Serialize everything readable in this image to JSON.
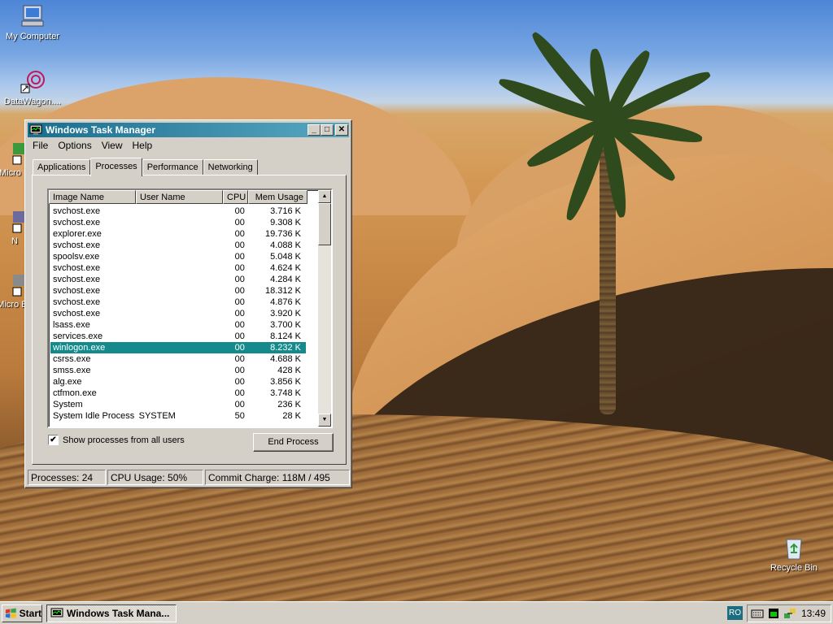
{
  "desktop": {
    "icons": [
      {
        "label": "My Computer"
      },
      {
        "label": "DataWagon...."
      },
      {
        "label": "Micro D"
      },
      {
        "label": "N"
      },
      {
        "label": "Micro Ba"
      },
      {
        "label": "Recycle Bin"
      }
    ]
  },
  "window": {
    "title": "Windows Task Manager",
    "controls": {
      "minimize": "_",
      "maximize": "□",
      "close": "✕"
    },
    "menu": [
      "File",
      "Options",
      "View",
      "Help"
    ],
    "tabs": [
      "Applications",
      "Processes",
      "Performance",
      "Networking"
    ],
    "active_tab": "Processes",
    "columns": [
      "Image Name",
      "User Name",
      "CPU",
      "Mem Usage"
    ],
    "processes": [
      {
        "name": "svchost.exe",
        "user": "",
        "cpu": "00",
        "mem": "3.716 K"
      },
      {
        "name": "svchost.exe",
        "user": "",
        "cpu": "00",
        "mem": "9.308 K"
      },
      {
        "name": "explorer.exe",
        "user": "",
        "cpu": "00",
        "mem": "19.736 K"
      },
      {
        "name": "svchost.exe",
        "user": "",
        "cpu": "00",
        "mem": "4.088 K"
      },
      {
        "name": "spoolsv.exe",
        "user": "",
        "cpu": "00",
        "mem": "5.048 K"
      },
      {
        "name": "svchost.exe",
        "user": "",
        "cpu": "00",
        "mem": "4.624 K"
      },
      {
        "name": "svchost.exe",
        "user": "",
        "cpu": "00",
        "mem": "4.284 K"
      },
      {
        "name": "svchost.exe",
        "user": "",
        "cpu": "00",
        "mem": "18.312 K"
      },
      {
        "name": "svchost.exe",
        "user": "",
        "cpu": "00",
        "mem": "4.876 K"
      },
      {
        "name": "svchost.exe",
        "user": "",
        "cpu": "00",
        "mem": "3.920 K"
      },
      {
        "name": "lsass.exe",
        "user": "",
        "cpu": "00",
        "mem": "3.700 K"
      },
      {
        "name": "services.exe",
        "user": "",
        "cpu": "00",
        "mem": "8.124 K"
      },
      {
        "name": "winlogon.exe",
        "user": "",
        "cpu": "00",
        "mem": "8.232 K",
        "selected": true
      },
      {
        "name": "csrss.exe",
        "user": "",
        "cpu": "00",
        "mem": "4.688 K"
      },
      {
        "name": "smss.exe",
        "user": "",
        "cpu": "00",
        "mem": "428 K"
      },
      {
        "name": "alg.exe",
        "user": "",
        "cpu": "00",
        "mem": "3.856 K"
      },
      {
        "name": "ctfmon.exe",
        "user": "",
        "cpu": "00",
        "mem": "3.748 K"
      },
      {
        "name": "System",
        "user": "",
        "cpu": "00",
        "mem": "236 K"
      },
      {
        "name": "System Idle Process",
        "user": "SYSTEM",
        "cpu": "50",
        "mem": "28 K"
      }
    ],
    "show_all_label": "Show processes from all users",
    "show_all_checked": "✔",
    "end_process_label": "End Process",
    "status": {
      "processes": "Processes: 24",
      "cpu": "CPU Usage: 50%",
      "commit": "Commit Charge: 118M / 495"
    }
  },
  "taskbar": {
    "start_label": "Start",
    "task_button_label": "Windows Task Mana...",
    "language": "RO",
    "clock": "13:49"
  },
  "colors": {
    "selection": "#148a8c",
    "titlebar_start": "#1a6e8e",
    "titlebar_end": "#58a8c2",
    "face": "#d4d0c8"
  }
}
